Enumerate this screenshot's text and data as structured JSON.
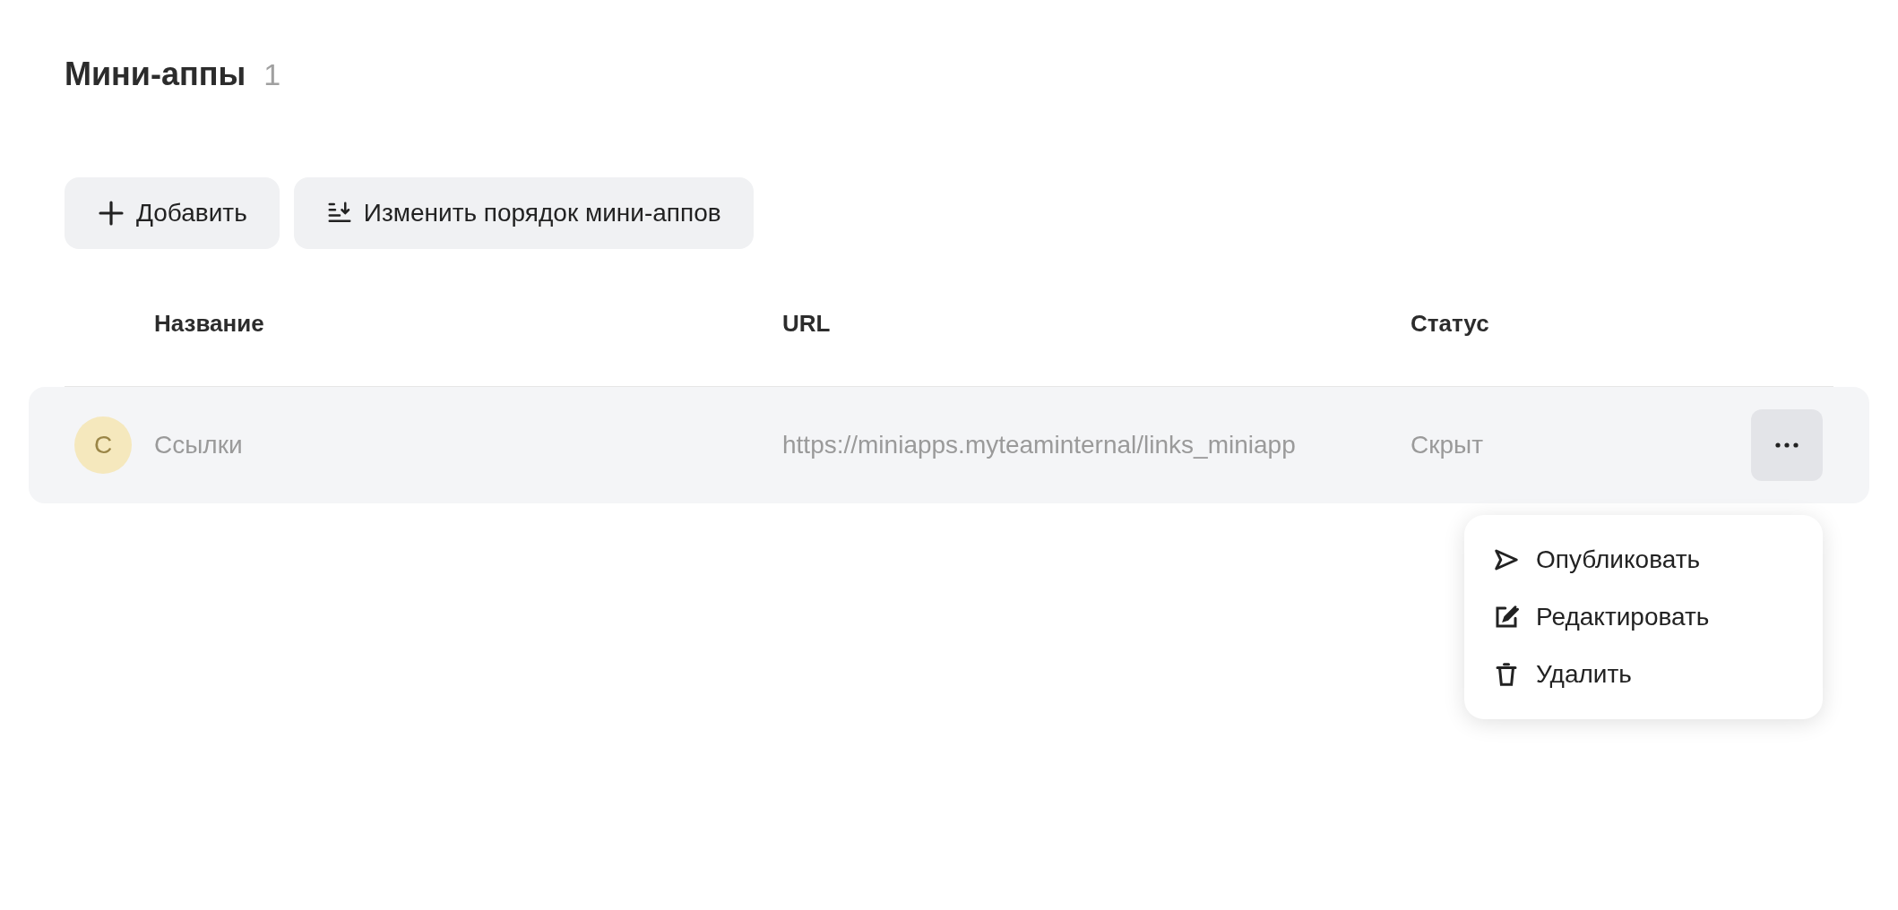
{
  "page": {
    "title": "Мини-аппы",
    "count": "1"
  },
  "toolbar": [
    {
      "kind": "add",
      "label": "Добавить"
    },
    {
      "kind": "reorder",
      "label": "Изменить порядок мини-аппов"
    }
  ],
  "table": {
    "columns": [
      "Название",
      "URL",
      "Статус"
    ],
    "rows": [
      {
        "avatar_letter": "С",
        "color": "#f5e8bd",
        "name": "Ссылки",
        "url": "https://miniapps.myteaminternal/links_miniapp",
        "status": "Скрыт",
        "menu_open": true
      }
    ]
  },
  "row_menu": [
    {
      "kind": "publish",
      "label": "Опубликовать"
    },
    {
      "kind": "edit",
      "label": "Редактировать"
    },
    {
      "kind": "delete",
      "label": "Удалить"
    }
  ]
}
